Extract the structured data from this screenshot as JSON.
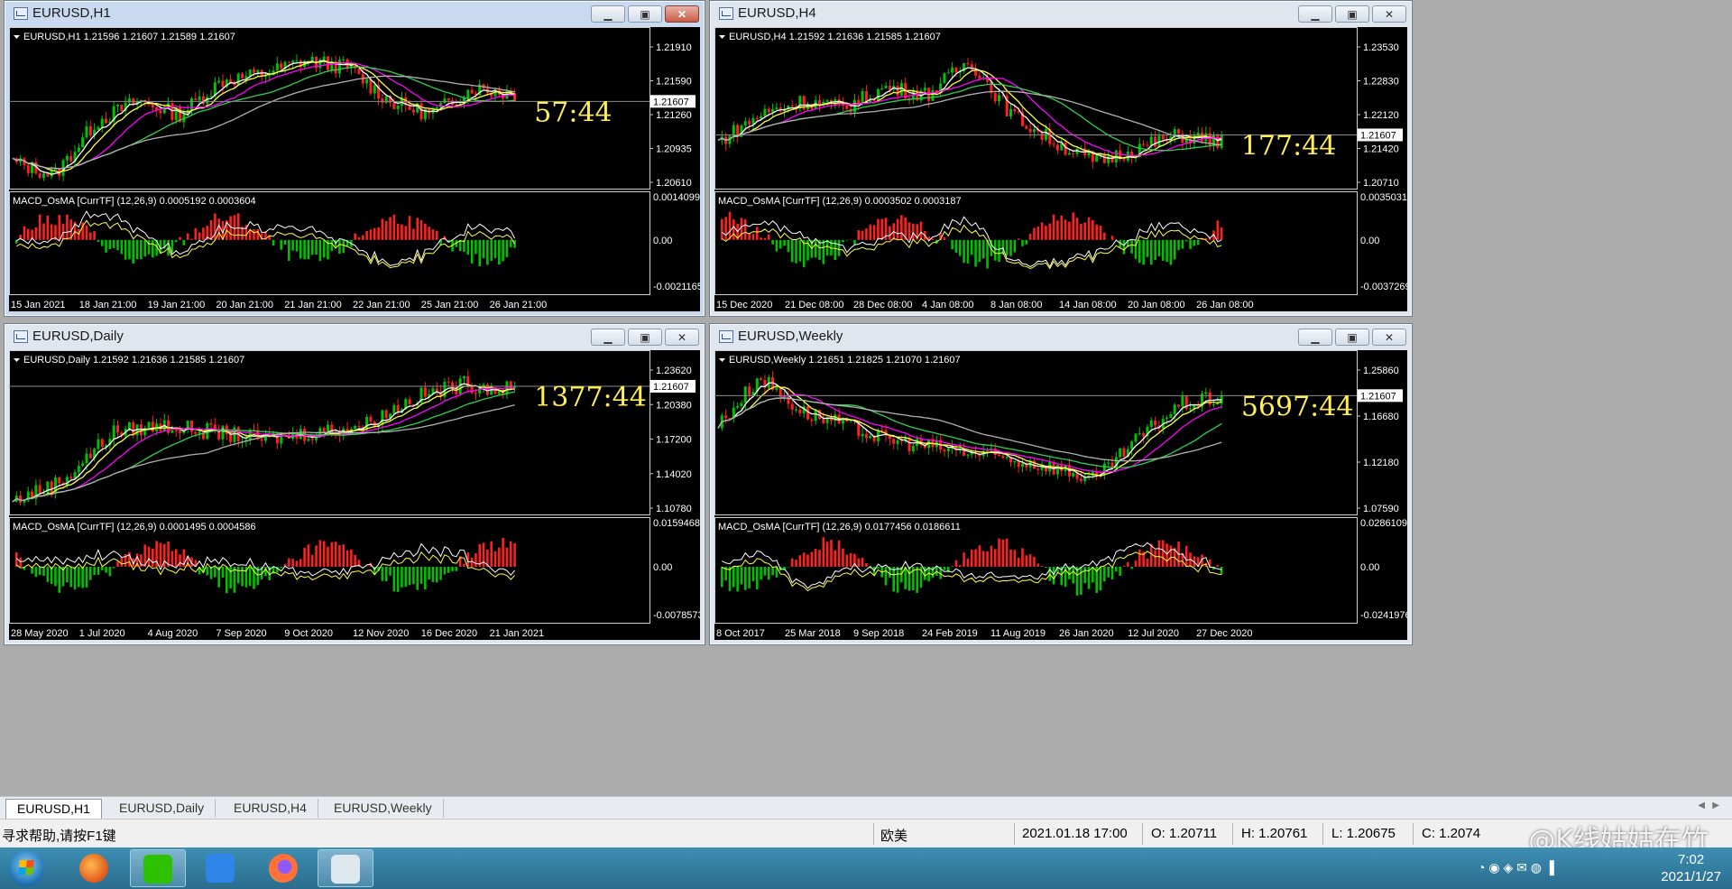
{
  "windows": [
    {
      "title": "EURUSD,H1",
      "info": "EURUSD,H1  1.21596 1.21607 1.21589 1.21607",
      "current_price": "1.21607",
      "timer": "57:44",
      "price_axis": [
        "1.21910",
        "1.21590",
        "1.21260",
        "1.20935",
        "1.20610"
      ],
      "macd_info": "MACD_OsMA [CurrTF] (12,26,9) 0.0005192 0.0003604",
      "macd_axis": [
        "0.0014099",
        "0.00",
        "-0.0021165"
      ],
      "time_axis": [
        "15 Jan 2021",
        "18 Jan 21:00",
        "19 Jan 21:00",
        "20 Jan 21:00",
        "21 Jan 21:00",
        "22 Jan 21:00",
        "25 Jan 21:00",
        "26 Jan 21:00"
      ]
    },
    {
      "title": "EURUSD,H4",
      "info": "EURUSD,H4  1.21592 1.21636 1.21585 1.21607",
      "current_price": "1.21607",
      "timer": "177:44",
      "price_axis": [
        "1.23530",
        "1.22830",
        "1.22120",
        "1.21420",
        "1.20710"
      ],
      "macd_info": "MACD_OsMA [CurrTF] (12,26,9) 0.0003502 0.0003187",
      "macd_axis": [
        "0.0035031",
        "0.00",
        "-0.0037269"
      ],
      "time_axis": [
        "15 Dec 2020",
        "21 Dec 08:00",
        "28 Dec 08:00",
        "4 Jan 08:00",
        "8 Jan 08:00",
        "14 Jan 08:00",
        "20 Jan 08:00",
        "26 Jan 08:00"
      ]
    },
    {
      "title": "EURUSD,Daily",
      "info": "EURUSD,Daily  1.21592 1.21636 1.21585 1.21607",
      "current_price": "1.21607",
      "timer": "1377:44",
      "price_axis": [
        "1.23620",
        "1.20380",
        "1.17200",
        "1.14020",
        "1.10780"
      ],
      "macd_info": "MACD_OsMA [CurrTF] (12,26,9) 0.0001495 0.0004586",
      "macd_axis": [
        "0.0159468",
        "0.00",
        "-0.0078573"
      ],
      "time_axis": [
        "28 May 2020",
        "1 Jul 2020",
        "4 Aug 2020",
        "7 Sep 2020",
        "9 Oct 2020",
        "12 Nov 2020",
        "16 Dec 2020",
        "21 Jan 2021"
      ]
    },
    {
      "title": "EURUSD,Weekly",
      "info": "EURUSD,Weekly  1.21651 1.21825 1.21070 1.21607",
      "current_price": "1.21607",
      "timer": "5697:44",
      "price_axis": [
        "1.25860",
        "1.16680",
        "1.12180",
        "1.07590"
      ],
      "macd_info": "MACD_OsMA [CurrTF] (12,26,9) 0.0177456 0.0186611",
      "macd_axis": [
        "0.0286109",
        "0.00",
        "-0.0241976"
      ],
      "time_axis": [
        "8 Oct 2017",
        "25 Mar 2018",
        "9 Sep 2018",
        "24 Feb 2019",
        "11 Aug 2019",
        "26 Jan 2020",
        "12 Jul 2020",
        "27 Dec 2020"
      ]
    }
  ],
  "tabs": [
    "EURUSD,H1",
    "EURUSD,Daily",
    "EURUSD,H4",
    "EURUSD,Weekly"
  ],
  "status": {
    "help": "寻求帮助,请按F1键",
    "profile": "欧美",
    "time": "2021.01.18 17:00",
    "open": "O: 1.20711",
    "high": "H: 1.20761",
    "low": "L: 1.20675",
    "close": "C: 1.2074"
  },
  "watermark": "@K线姑姑在竹",
  "clock": {
    "time": "7:02",
    "date": "2021/1/27"
  },
  "colors": {
    "bull": "#00c000",
    "bear": "#ff2020",
    "ma_white": "#ffffff",
    "ma_yellow": "#ffff40",
    "ma_magenta": "#ff00ff",
    "ma_green": "#30d050",
    "ma_gray": "#b0b0b0",
    "timer": "#ffee55",
    "taskbar": "#2f7aa0"
  }
}
